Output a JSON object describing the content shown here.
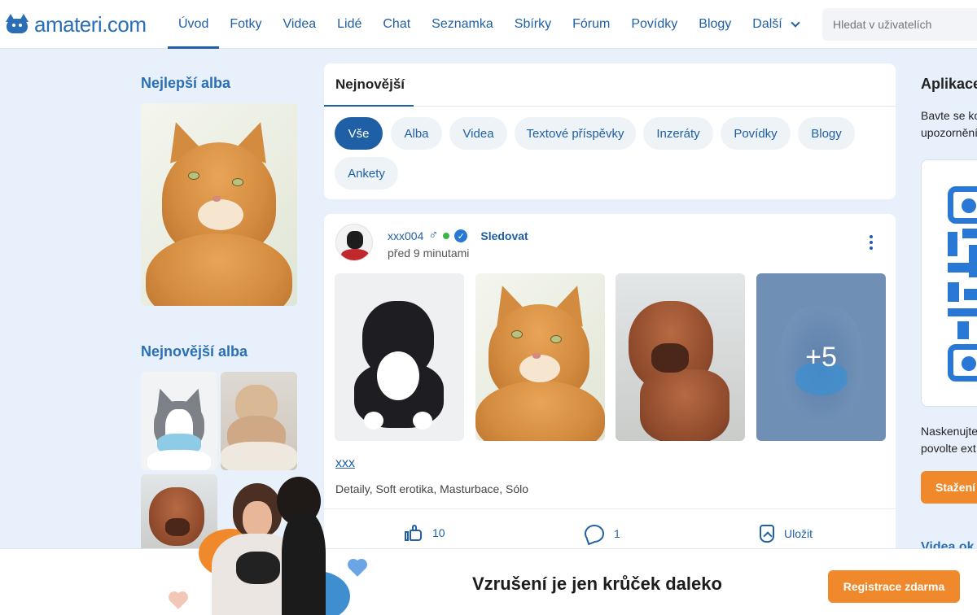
{
  "header": {
    "logo_text": "amateri.com",
    "nav": [
      {
        "label": "Úvod",
        "active": true
      },
      {
        "label": "Fotky"
      },
      {
        "label": "Videa"
      },
      {
        "label": "Lidé"
      },
      {
        "label": "Chat"
      },
      {
        "label": "Seznamka"
      },
      {
        "label": "Sbírky"
      },
      {
        "label": "Fórum"
      },
      {
        "label": "Povídky"
      },
      {
        "label": "Blogy"
      },
      {
        "label": "Další"
      }
    ],
    "search_placeholder": "Hledat v uživatelích"
  },
  "left": {
    "best_albums_title": "Nejlepší alba",
    "newest_albums_title": "Nejnovější alba"
  },
  "feed": {
    "tab_title": "Nejnovější",
    "filters": [
      "Vše",
      "Alba",
      "Videa",
      "Textové příspěvky",
      "Inzeráty",
      "Povídky",
      "Blogy",
      "Ankety"
    ],
    "active_filter": "Vše",
    "post": {
      "username": "xxx004",
      "gender_icon": "male-icon",
      "follow_label": "Sledovat",
      "time": "před 9 minutami",
      "more_count": "+5",
      "title": "xxx",
      "tags": "Detaily, Soft erotika, Masturbace, Sólo",
      "likes": "10",
      "comments": "1",
      "save_label": "Uložit"
    }
  },
  "right": {
    "title": "Aplikace",
    "line1": "Bavte se ko",
    "line2": "upozornění",
    "scan_line1": "Naskenujte",
    "scan_line2": "povolte ext",
    "download_label": "Stažení",
    "next_title": "Videa ok"
  },
  "banner": {
    "text": "Vzrušení je jen krůček daleko",
    "register_label": "Registrace zdarma"
  },
  "colors": {
    "primary": "#1f5fa6",
    "accent": "#f0892b",
    "background": "#e8f1fb"
  }
}
